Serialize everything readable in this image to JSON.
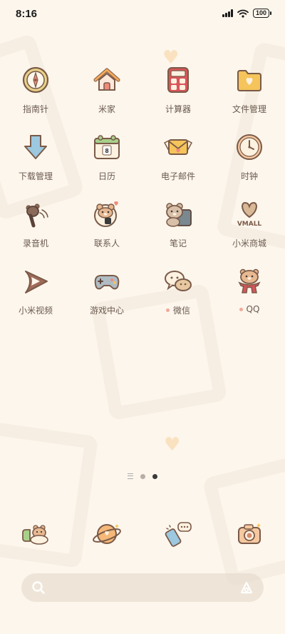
{
  "status_bar": {
    "time": "8:16",
    "battery": "100"
  },
  "apps": [
    {
      "label": "指南针",
      "icon": "compass-icon",
      "badge": false
    },
    {
      "label": "米家",
      "icon": "home-icon",
      "badge": false
    },
    {
      "label": "计算器",
      "icon": "calculator-icon",
      "badge": false
    },
    {
      "label": "文件管理",
      "icon": "folder-icon",
      "badge": false
    },
    {
      "label": "下载管理",
      "icon": "download-arrow-icon",
      "badge": false
    },
    {
      "label": "日历",
      "icon": "calendar-icon",
      "badge": false
    },
    {
      "label": "电子邮件",
      "icon": "mail-envelope-icon",
      "badge": false
    },
    {
      "label": "时钟",
      "icon": "clock-icon",
      "badge": false
    },
    {
      "label": "录音机",
      "icon": "microphone-icon",
      "badge": false
    },
    {
      "label": "联系人",
      "icon": "contacts-bear-icon",
      "badge": false
    },
    {
      "label": "笔记",
      "icon": "notes-bear-icon",
      "badge": false
    },
    {
      "label": "小米商城",
      "icon": "vmall-heart-icon",
      "badge": false
    },
    {
      "label": "小米视频",
      "icon": "video-play-icon",
      "badge": false
    },
    {
      "label": "游戏中心",
      "icon": "gamepad-icon",
      "badge": false
    },
    {
      "label": "微信",
      "icon": "wechat-bubble-icon",
      "badge": true
    },
    {
      "label": "QQ",
      "icon": "qq-bear-icon",
      "badge": true
    }
  ],
  "calendar_day": "8",
  "vmall_text": "VMALL",
  "dock": [
    {
      "icon": "phone-bear-icon"
    },
    {
      "icon": "planet-icon"
    },
    {
      "icon": "messages-icon"
    },
    {
      "icon": "camera-icon"
    }
  ],
  "colors": {
    "background": "#fdf6ec",
    "label": "#6b5a50",
    "badge": "#f0a898"
  }
}
